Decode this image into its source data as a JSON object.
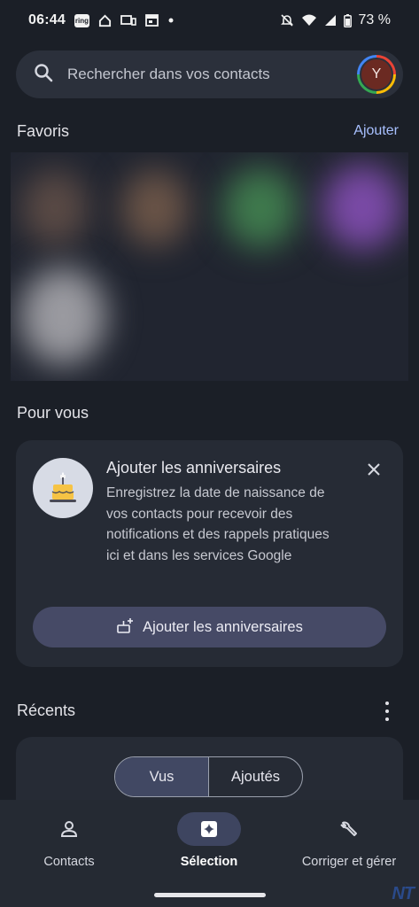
{
  "status_bar": {
    "time": "06:44",
    "ring_badge": "ring",
    "battery": "73 %"
  },
  "search": {
    "placeholder": "Rechercher dans vos contacts",
    "avatar_initial": "Y"
  },
  "favorites": {
    "title": "Favoris",
    "add_label": "Ajouter"
  },
  "for_you": {
    "title": "Pour vous",
    "card": {
      "title": "Ajouter les anniversaires",
      "body": "Enregistrez la date de naissance de vos contacts pour recevoir des notifications et des rappels pratiques ici et dans les services Google",
      "button_label": "Ajouter les anniversaires"
    }
  },
  "recents": {
    "title": "Récents",
    "tabs": [
      {
        "label": "Vus",
        "selected": true
      },
      {
        "label": "Ajoutés",
        "selected": false
      }
    ]
  },
  "bottom_nav": {
    "items": [
      {
        "label": "Contacts",
        "icon": "person-icon",
        "active": false
      },
      {
        "label": "Sélection",
        "icon": "sparkle-icon",
        "active": true
      },
      {
        "label": "Corriger et gérer",
        "icon": "wrench-icon",
        "active": false
      }
    ]
  },
  "watermark": "NT",
  "colors": {
    "background": "#1b1f27",
    "surface": "#262b35",
    "accent_link": "#a8c0ff",
    "button_fill": "#464a66"
  }
}
